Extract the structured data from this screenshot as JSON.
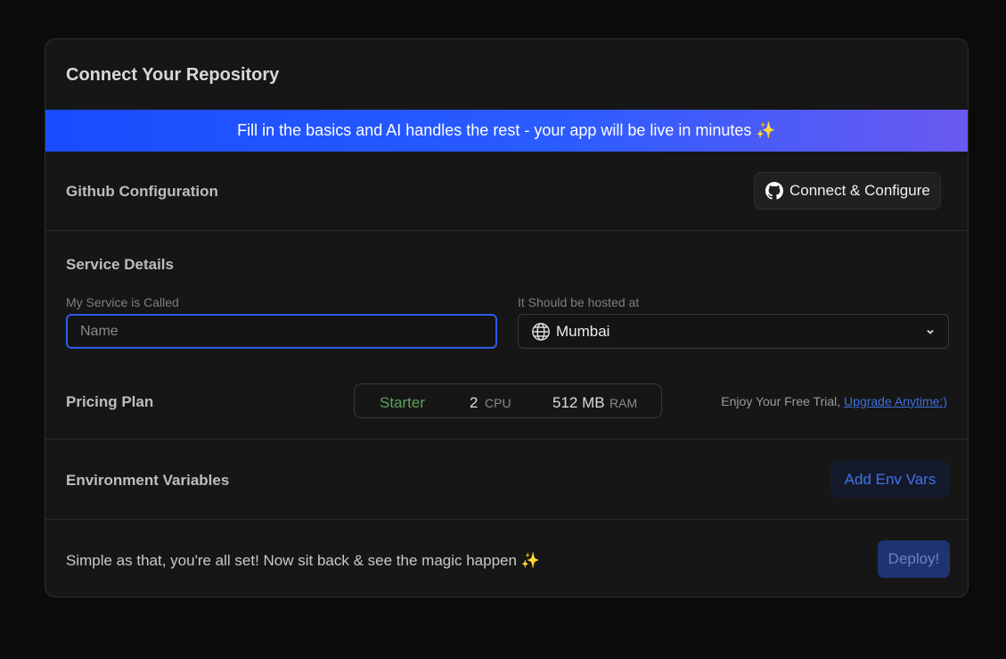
{
  "title": "Connect Your Repository",
  "banner": {
    "text": "Fill in the basics and AI handles the rest - your app will be live in minutes ✨"
  },
  "github": {
    "label": "Github Configuration",
    "button_label": "Connect & Configure",
    "icon": "github-icon"
  },
  "service": {
    "label": "Service Details",
    "name_label": "My Service is Called",
    "name_placeholder": "Name",
    "name_value": "",
    "host_label": "It Should be hosted at",
    "host_value": "Mumbai",
    "host_icon": "globe-icon"
  },
  "pricing": {
    "label": "Pricing Plan",
    "plan_name": "Starter",
    "cpu_value": "2",
    "cpu_unit": "CPU",
    "ram_value": "512 MB",
    "ram_unit": "RAM",
    "trial_text": "Enjoy Your Free Trial,",
    "upgrade_link": "Upgrade Anytime:)"
  },
  "env": {
    "label": "Environment Variables",
    "button_label": "Add Env Vars"
  },
  "footer": {
    "text": "Simple as that, you're all set! Now sit back & see the magic happen ✨",
    "deploy_label": "Deploy!"
  },
  "colors": {
    "accent": "#2d5be6",
    "banner_start": "#1a4cff",
    "banner_end": "#6a5af0",
    "plan_green": "#5ea15e"
  }
}
